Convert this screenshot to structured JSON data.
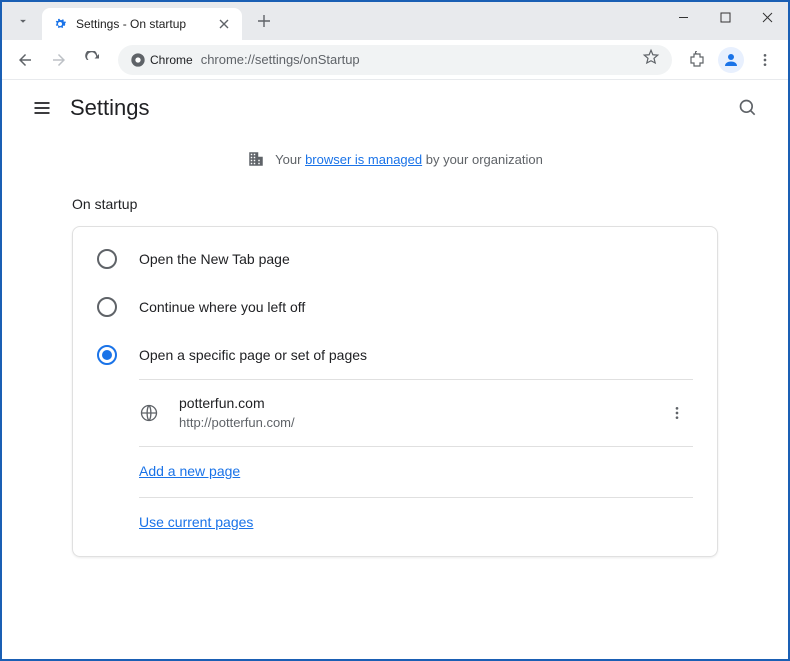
{
  "tab": {
    "title": "Settings - On startup"
  },
  "omnibox": {
    "label": "Chrome",
    "url": "chrome://settings/onStartup"
  },
  "header": {
    "title": "Settings"
  },
  "managed": {
    "prefix": "Your ",
    "link": "browser is managed",
    "suffix": " by your organization"
  },
  "section": {
    "title": "On startup"
  },
  "options": {
    "newtab": "Open the New Tab page",
    "continue": "Continue where you left off",
    "specific": "Open a specific page or set of pages"
  },
  "startup_page": {
    "name": "potterfun.com",
    "url": "http://potterfun.com/"
  },
  "links": {
    "add": "Add a new page",
    "current": "Use current pages"
  }
}
